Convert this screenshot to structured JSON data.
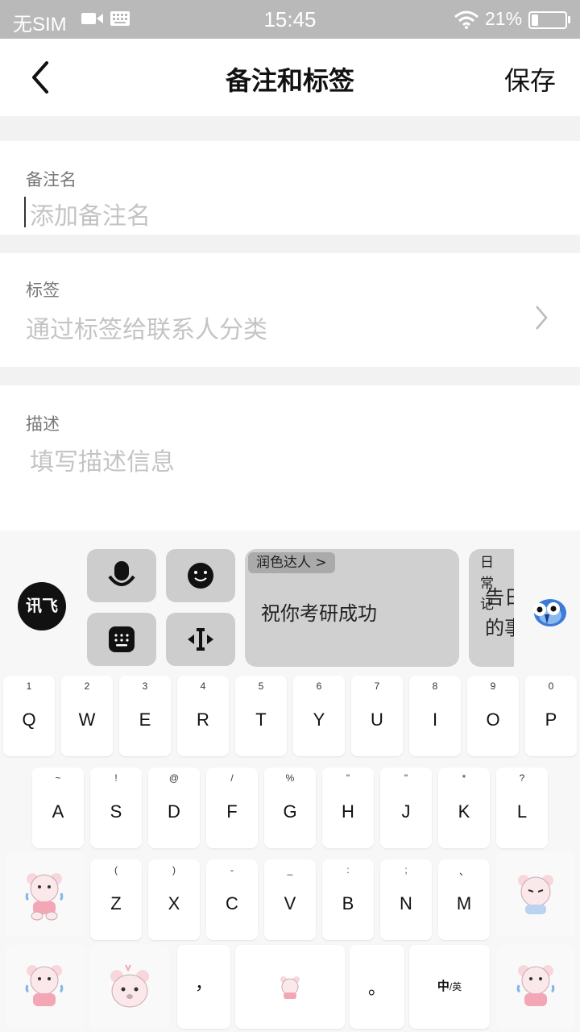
{
  "status_bar": {
    "carrier": "无SIM",
    "time": "15:45",
    "battery_pct": "21%",
    "battery_level": 0.21
  },
  "header": {
    "title": "备注和标签",
    "save_label": "保存"
  },
  "remark": {
    "label": "备注名",
    "placeholder": "添加备注名"
  },
  "tags": {
    "label": "标签",
    "placeholder": "通过标签给联系人分类"
  },
  "description": {
    "label": "描述",
    "placeholder": "填写描述信息"
  },
  "keyboard": {
    "logo": "讯飞",
    "suggestion_card_1": {
      "tag": "润色达人 >",
      "text": "祝你考研成功"
    },
    "suggestion_card_2": {
      "tag": "日常记",
      "text_line1": "告日",
      "text_line2": "的事"
    },
    "row1": [
      {
        "sub": "1",
        "main": "Q"
      },
      {
        "sub": "2",
        "main": "W"
      },
      {
        "sub": "3",
        "main": "E"
      },
      {
        "sub": "4",
        "main": "R"
      },
      {
        "sub": "5",
        "main": "T"
      },
      {
        "sub": "6",
        "main": "Y"
      },
      {
        "sub": "7",
        "main": "U"
      },
      {
        "sub": "8",
        "main": "I"
      },
      {
        "sub": "9",
        "main": "O"
      },
      {
        "sub": "0",
        "main": "P"
      }
    ],
    "row2": [
      {
        "sub": "~",
        "main": "A"
      },
      {
        "sub": "!",
        "main": "S"
      },
      {
        "sub": "@",
        "main": "D"
      },
      {
        "sub": "/",
        "main": "F"
      },
      {
        "sub": "%",
        "main": "G"
      },
      {
        "sub": "\"",
        "main": "H"
      },
      {
        "sub": "\"",
        "main": "J"
      },
      {
        "sub": "*",
        "main": "K"
      },
      {
        "sub": "?",
        "main": "L"
      }
    ],
    "row3": [
      {
        "sub": "(",
        "main": "Z"
      },
      {
        "sub": ")",
        "main": "X"
      },
      {
        "sub": "-",
        "main": "C"
      },
      {
        "sub": "_",
        "main": "V"
      },
      {
        "sub": ":",
        "main": "B"
      },
      {
        "sub": ";",
        "main": "N"
      },
      {
        "sub": "、",
        "main": "M"
      }
    ],
    "comma": "，",
    "period": "。",
    "lang_switch_main": "中",
    "lang_switch_sub": "/英"
  }
}
